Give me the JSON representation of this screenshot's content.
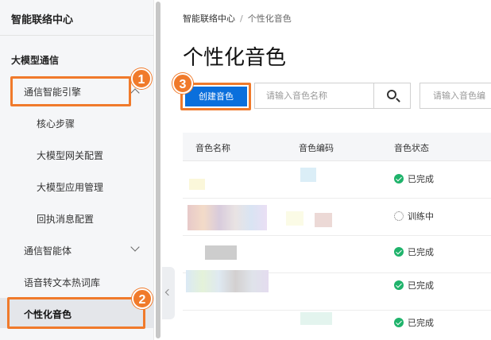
{
  "sidebar": {
    "title": "智能联络中心",
    "section": "大模型通信",
    "items": [
      {
        "label": "通信智能引擎"
      },
      {
        "label": "核心步骤"
      },
      {
        "label": "大模型网关配置"
      },
      {
        "label": "大模型应用管理"
      },
      {
        "label": "回执消息配置"
      },
      {
        "label": "通信智能体"
      },
      {
        "label": "语音转文本热词库"
      },
      {
        "label": "个性化音色"
      }
    ]
  },
  "callouts": [
    "1",
    "2",
    "3"
  ],
  "breadcrumb": {
    "root": "智能联络中心",
    "separator": "/",
    "current": "个性化音色"
  },
  "page": {
    "title": "个性化音色"
  },
  "toolbar": {
    "create_label": "创建音色",
    "search_placeholder": "请输入音色名称",
    "search2_placeholder": "请输入音色编"
  },
  "table": {
    "columns": [
      "音色名称",
      "音色编码",
      "音色状态"
    ],
    "rows": [
      {
        "status": "已完成",
        "state": "done"
      },
      {
        "status": "训练中",
        "state": "training"
      },
      {
        "status": "已完成",
        "state": "done"
      },
      {
        "status": "已完成",
        "state": "done"
      },
      {
        "status": "已完成",
        "state": "done"
      }
    ]
  },
  "colors": {
    "accent": "#0a6fdc",
    "callout": "#f07a2b",
    "success": "#1fb36b"
  }
}
